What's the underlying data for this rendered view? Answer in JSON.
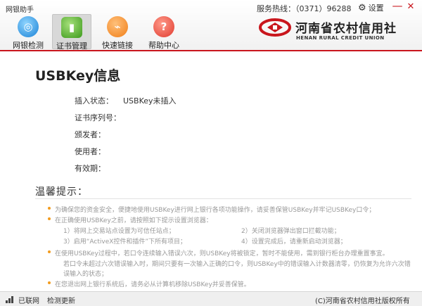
{
  "window": {
    "title": "网银助手",
    "hotline": "服务热线：（0371）96288",
    "settings_label": "设置",
    "minimize_glyph": "—",
    "close_glyph": "✕"
  },
  "toolbar": {
    "items": [
      {
        "label": "网银检测",
        "icon": "radar-icon",
        "glyph": "◎",
        "color": "#1b82d6"
      },
      {
        "label": "证书管理",
        "icon": "certificate-book-icon",
        "glyph": "▮",
        "color": "#3d9a1c"
      },
      {
        "label": "快速链接",
        "icon": "link-icon",
        "glyph": "⌁",
        "color": "#f07d16"
      },
      {
        "label": "帮助中心",
        "icon": "help-bubble-icon",
        "glyph": "?",
        "color": "#e0392d"
      }
    ],
    "active_index": 1
  },
  "logo": {
    "cn": "河南省农村信用社",
    "en": "HENAN RURAL CREDIT UNION",
    "color": "#c9161d"
  },
  "usbkey": {
    "title": "USBKey信息",
    "fields": [
      {
        "label": "插入状态：",
        "value": "USBKey未插入"
      },
      {
        "label": "证书序列号：",
        "value": ""
      },
      {
        "label": "颁发者：",
        "value": ""
      },
      {
        "label": "使用者：",
        "value": ""
      },
      {
        "label": "有效期：",
        "value": ""
      }
    ]
  },
  "tips": {
    "title": "温馨提示：",
    "items": [
      "为确保您的资金安全，便捷地使用USBKey进行网上银行各项功能操作，请妥善保管USBKey并牢记USBKey口令；",
      "在正确使用USBKey之前，请按照如下提示设置浏览器：",
      "在使用USBKey过程中，若口令连续输入错误六次，则USBKey将被锁定，暂时不能使用，需到银行柜台办理重置事宜。",
      "在您退出网上银行系统后，请务必从计算机移除USBKey并妥善保管。"
    ],
    "browser_steps": [
      "1）将网上交易站点设置为可信任站点；",
      "2）关闭浏览器弹出窗口拦截功能；",
      "3）启用“ActiveX控件和插件”下所有项目；",
      "4）设置完成后，请重新启动浏览器；"
    ],
    "lock_note_line2": "若口令未超过六次错误输入时，期间只要有一次输入正确的口令，则USBKey中的错误输入计数器清零，仍恢复为允许六次错",
    "lock_note_line3": "误输入的状态；",
    "bullet_color": "#f29c1f"
  },
  "status": {
    "network": "已联网",
    "update": "检测更新",
    "copyright": "(C)河南省农村信用社版权所有"
  }
}
